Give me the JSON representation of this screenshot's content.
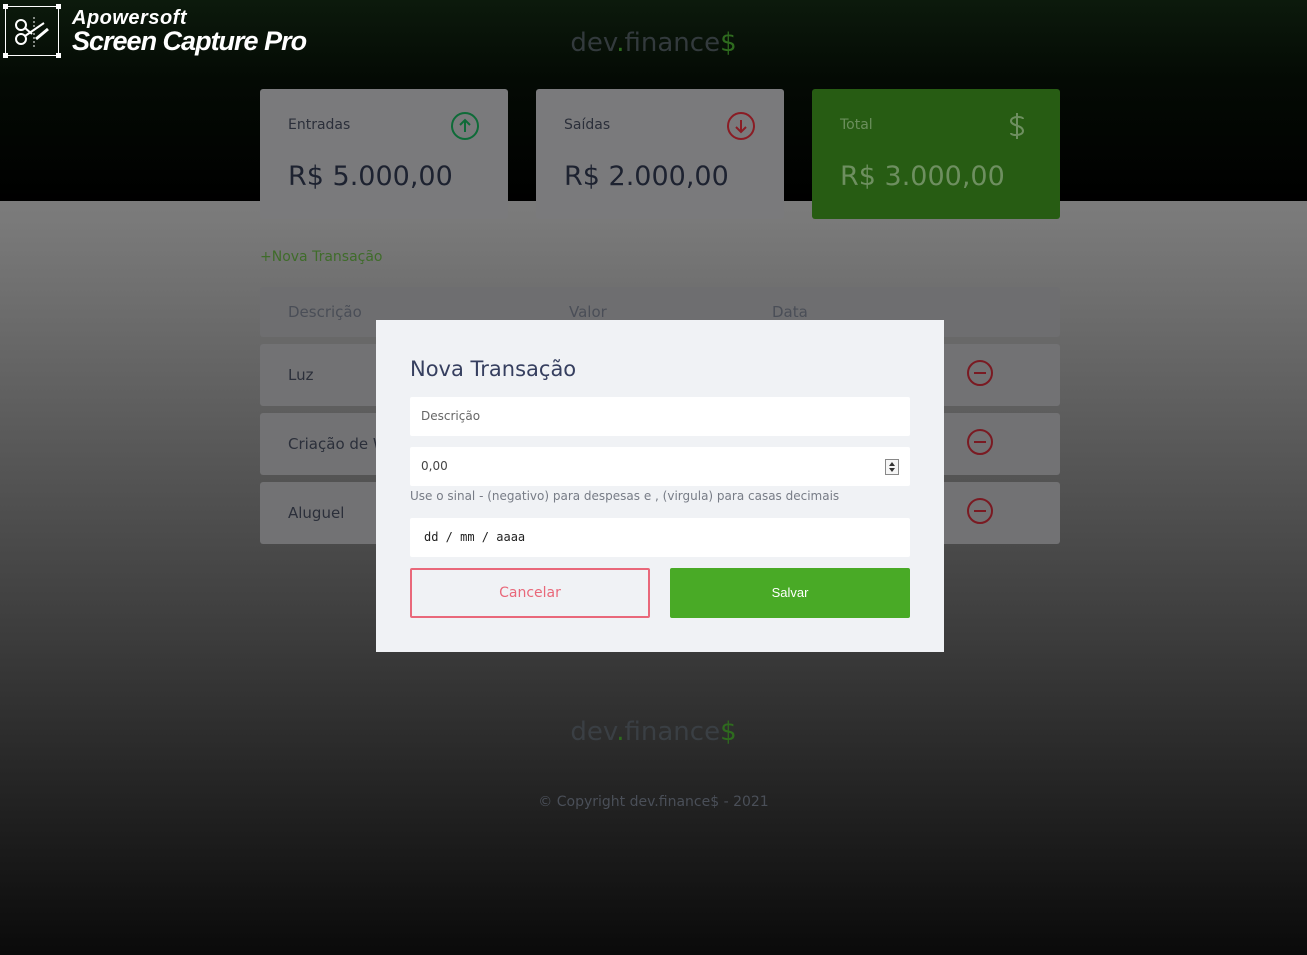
{
  "watermark": {
    "line1": "Apowersoft",
    "line2": "Screen Capture Pro",
    "icon": "scissors-icon"
  },
  "header": {
    "logo_main": "dev",
    "logo_dot": ".",
    "logo_rest": "finance",
    "logo_dollar": "$"
  },
  "cards": {
    "income": {
      "label": "Entradas",
      "amount": "R$ 5.000,00",
      "icon": "arrow-up-circle-icon",
      "icon_color": "#12a454"
    },
    "expense": {
      "label": "Saídas",
      "amount": "R$ 2.000,00",
      "icon": "arrow-down-circle-icon",
      "icon_color": "#e92929"
    },
    "total": {
      "label": "Total",
      "amount": "R$ 3.000,00",
      "icon": "dollar-sign-icon",
      "bg_color": "#49aa26"
    }
  },
  "transactions": {
    "new_link": "+Nova Transação",
    "headers": [
      "Descrição",
      "Valor",
      "Data"
    ],
    "rows": [
      {
        "description": "Luz"
      },
      {
        "description": "Criação de W"
      },
      {
        "description": "Aluguel"
      }
    ]
  },
  "footer": {
    "logo_main": "dev",
    "logo_dot": ".",
    "logo_rest": "finance",
    "logo_dollar": "$",
    "copyright": "© Copyright dev.finance$ - 2021"
  },
  "modal": {
    "title": "Nova Transação",
    "description_placeholder": "Descrição",
    "amount_value": "0,00",
    "helper": "Use o sinal - (negativo) para despesas e , (virgula) para casas decimais",
    "date_placeholder": "dd / mm / aaaa",
    "cancel_label": "Cancelar",
    "save_label": "Salvar"
  },
  "colors": {
    "accent_green": "#49aa26",
    "danger_red": "#e92929",
    "title_navy": "#363f5f"
  }
}
